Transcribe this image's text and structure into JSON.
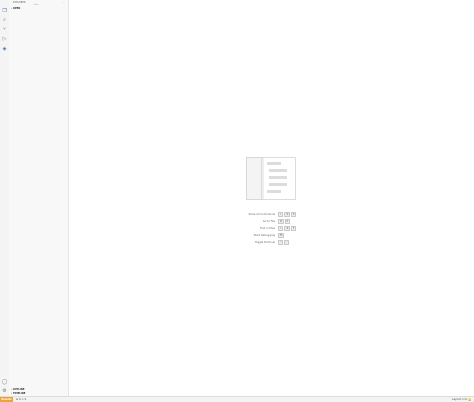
{
  "activity_bar": {
    "items": [
      {
        "name": "explorer-icon",
        "glyph": "❐"
      },
      {
        "name": "search-icon",
        "glyph": "⌕"
      },
      {
        "name": "source-control-icon",
        "glyph": "⑂"
      },
      {
        "name": "run-debug-icon",
        "glyph": "▷"
      },
      {
        "name": "extensions-icon",
        "glyph": "◈"
      }
    ],
    "bottom": [
      {
        "name": "account-icon",
        "glyph": "◯"
      },
      {
        "name": "settings-gear-icon",
        "glyph": "⚙"
      }
    ]
  },
  "sidebar": {
    "title": "EXPLORER",
    "header": "› OPEN",
    "input_placeholder": "filter",
    "outline_label": "› OUTLINE",
    "timeline_label": "› TIMELINE"
  },
  "editor": {
    "shortcuts": [
      {
        "label": "Show All Commands",
        "keys": [
          "⇧",
          "⌘",
          "P"
        ]
      },
      {
        "label": "Go to File",
        "keys": [
          "⌘",
          "P"
        ]
      },
      {
        "label": "Find in Files",
        "keys": [
          "⇧",
          "⌘",
          "F"
        ]
      },
      {
        "label": "Start Debugging",
        "keys": [
          "F5"
        ]
      },
      {
        "label": "Toggle Terminal",
        "keys": [
          "⌃",
          "`"
        ]
      }
    ]
  },
  "status_bar": {
    "remote_label": "Remote",
    "branch": "⊗ 0 ⚠ 0",
    "right_text": "Layout: U.S.",
    "bell": "🔔"
  },
  "colors": {
    "accent": "#f0a23a",
    "activity_bg": "#f4f4f4",
    "sidebar_bg": "#f8f8f8"
  }
}
